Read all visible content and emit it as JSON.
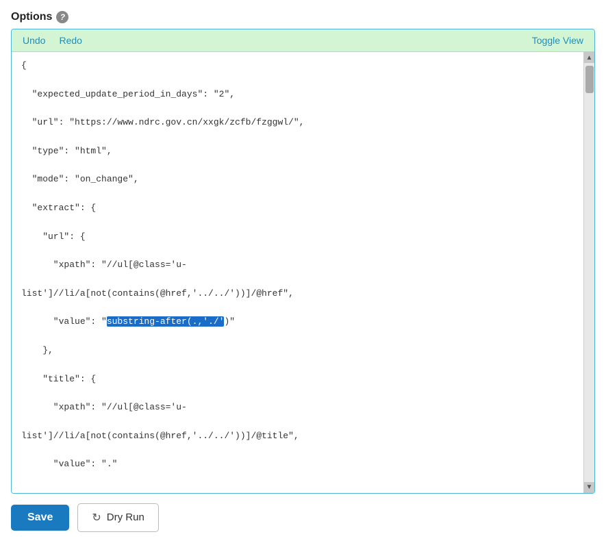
{
  "header": {
    "title": "Options",
    "help_icon": "?"
  },
  "toolbar": {
    "undo_label": "Undo",
    "redo_label": "Redo",
    "toggle_view_label": "Toggle View"
  },
  "code_editor": {
    "lines": [
      "{",
      "  \"expected_update_period_in_days\": \"2\",",
      "  \"url\": \"https://www.ndrc.gov.cn/xxgk/zcfb/fzggwl/\",",
      "  \"type\": \"html\",",
      "  \"mode\": \"on_change\",",
      "  \"extract\": {",
      "    \"url\": {",
      "      \"xpath\": \"//ul[@class='u-",
      "list']//li/a[not(contains(@href,'../../'))]/@href\",",
      "      \"value\": \"substring-after(.,'./'​)\"",
      "    },",
      "    \"title\": {",
      "      \"xpath\": \"//ul[@class='u-",
      "list']//li/a[not(contains(@href,'../../'))]/@title\",",
      "      \"value\": \".\""
    ],
    "highlighted_text": "substring-after(.,'./'"
  },
  "footer": {
    "save_label": "Save",
    "dry_run_label": "Dry Run",
    "refresh_icon": "↻"
  }
}
